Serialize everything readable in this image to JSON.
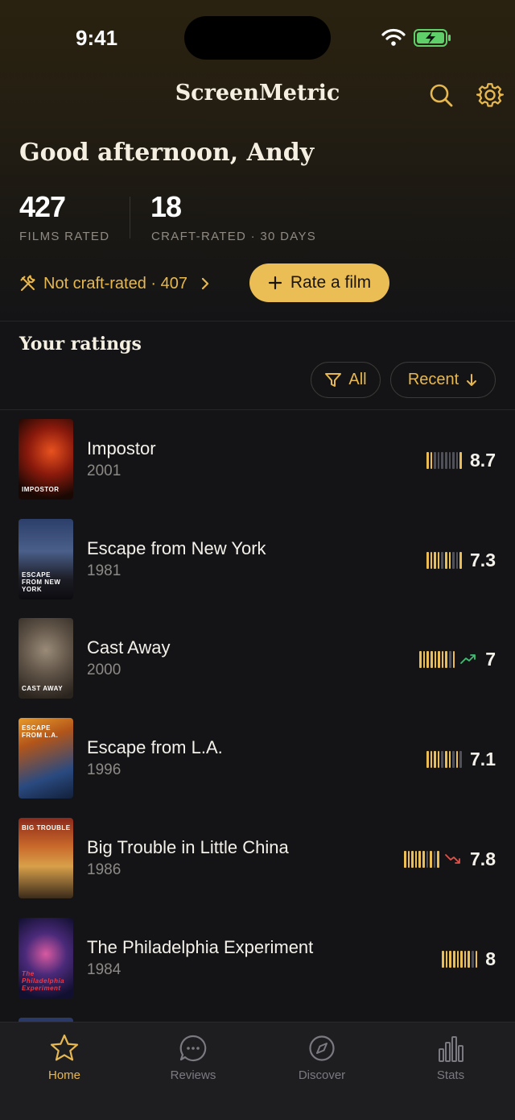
{
  "status": {
    "time": "9:41"
  },
  "header": {
    "title": "ScreenMetric"
  },
  "greeting": "Good afternoon, Andy",
  "stats": [
    {
      "value": "427",
      "label": "FILMS RATED"
    },
    {
      "value": "18",
      "label": "CRAFT-RATED · 30 DAYS"
    }
  ],
  "actions": {
    "not_craft": "Not craft-rated · 407",
    "rate_film": "Rate a film"
  },
  "ratings_section": {
    "title": "Your ratings",
    "filter_label": "All",
    "sort_label": "Recent"
  },
  "colors": {
    "accent": "#ebbd55",
    "trend_up": "#3fbf73",
    "trend_down": "#e0524a"
  },
  "movies": [
    {
      "title": "Impostor",
      "year": "2001",
      "rating": "8.7",
      "bars": [
        1,
        1,
        0,
        0,
        0,
        0,
        0,
        0,
        0,
        1
      ],
      "trend": null,
      "poster_caption": "IMPOSTOR"
    },
    {
      "title": "Escape from New York",
      "year": "1981",
      "rating": "7.3",
      "bars": [
        1,
        1,
        1,
        1,
        0,
        1,
        1,
        0,
        0,
        1
      ],
      "trend": null,
      "poster_caption": "ESCAPE FROM NEW YORK"
    },
    {
      "title": "Cast Away",
      "year": "2000",
      "rating": "7",
      "bars": [
        1,
        1,
        1,
        1,
        1,
        1,
        1,
        1,
        0,
        1
      ],
      "trend": "up",
      "poster_caption": "CAST AWAY"
    },
    {
      "title": "Escape from L.A.",
      "year": "1996",
      "rating": "7.1",
      "bars": [
        1,
        1,
        1,
        1,
        0,
        1,
        1,
        0,
        1,
        0
      ],
      "trend": null,
      "poster_caption": "ESCAPE FROM L.A."
    },
    {
      "title": "Big Trouble in Little China",
      "year": "1986",
      "rating": "7.8",
      "bars": [
        1,
        1,
        1,
        1,
        1,
        1,
        0,
        1,
        0,
        1
      ],
      "trend": "down",
      "poster_caption": "BIG TROUBLE"
    },
    {
      "title": "The Philadelphia Experiment",
      "year": "1984",
      "rating": "8",
      "bars": [
        1,
        1,
        1,
        1,
        1,
        1,
        1,
        1,
        0,
        1
      ],
      "trend": null,
      "poster_caption": "The Philadelphia Experiment"
    }
  ],
  "tabs": [
    {
      "label": "Home",
      "icon": "star-icon",
      "active": true
    },
    {
      "label": "Reviews",
      "icon": "chat-bubble-icon",
      "active": false
    },
    {
      "label": "Discover",
      "icon": "compass-icon",
      "active": false
    },
    {
      "label": "Stats",
      "icon": "bar-chart-icon",
      "active": false
    }
  ]
}
